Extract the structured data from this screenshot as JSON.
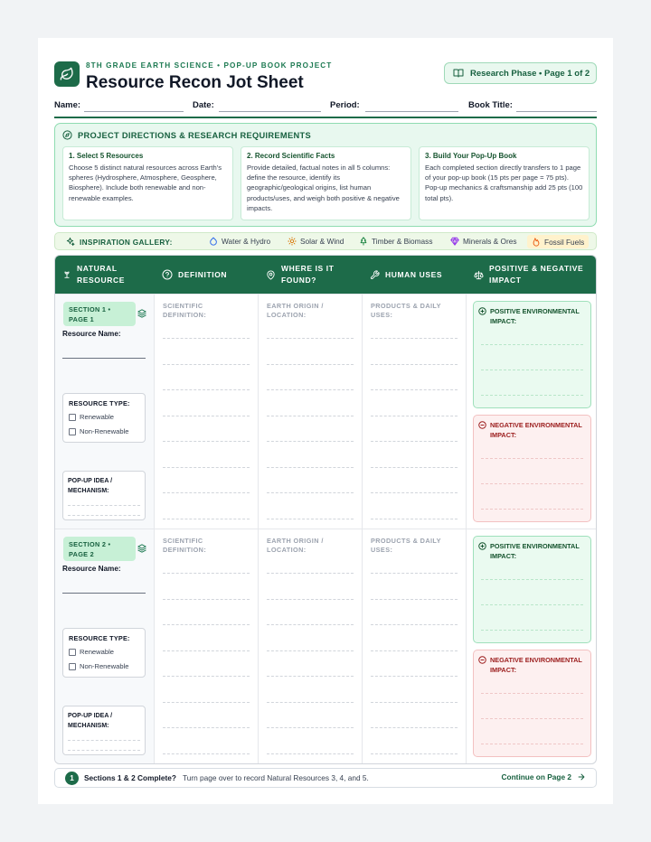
{
  "header": {
    "kicker": "8TH GRADE EARTH SCIENCE • POP-UP BOOK PROJECT",
    "title": "Resource Recon Jot Sheet",
    "phase_badge": "Research Phase • Page 1 of 2",
    "logo_icon": "leaf-icon",
    "phase_icon": "book-icon"
  },
  "info_fields": {
    "name": "Name:",
    "date": "Date:",
    "period": "Period:",
    "book_title": "Book Title:"
  },
  "directions": {
    "heading": "PROJECT DIRECTIONS & RESEARCH REQUIREMENTS",
    "icon": "compass-icon",
    "cards": [
      {
        "title": "1. Select 5 Resources",
        "body": "Choose 5 distinct natural resources across Earth's spheres (Hydrosphere, Atmosphere, Geosphere, Biosphere). Include both renewable and non-renewable examples."
      },
      {
        "title": "2. Record Scientific Facts",
        "body": "Provide detailed, factual notes in all 5 columns: define the resource, identify its geographic/geological origins, list human products/uses, and weigh both positive & negative impacts."
      },
      {
        "title": "3. Build Your Pop-Up Book",
        "body": "Each completed section directly transfers to 1 page of your pop-up book (15 pts per page = 75 pts). Pop-up mechanics & craftsmanship add 25 pts (100 total pts)."
      }
    ]
  },
  "gallery": {
    "label": "INSPIRATION GALLERY:",
    "items": [
      {
        "label": "Water & Hydro",
        "icon": "droplet-icon"
      },
      {
        "label": "Solar & Wind",
        "icon": "sun-icon"
      },
      {
        "label": "Timber & Biomass",
        "icon": "tree-icon"
      },
      {
        "label": "Minerals & Ores",
        "icon": "gem-icon"
      },
      {
        "label": "Fossil Fuels",
        "icon": "flame-icon"
      }
    ]
  },
  "table": {
    "headers": [
      {
        "label_line1": "NATURAL",
        "label_line2": "RESOURCE",
        "icon": "sprout-icon"
      },
      {
        "label_line1": "DEFINITION",
        "label_line2": "",
        "icon": "help-circle-icon"
      },
      {
        "label_line1": "WHERE IS IT",
        "label_line2": "FOUND?",
        "icon": "map-pin-icon"
      },
      {
        "label_line1": "HUMAN USES",
        "label_line2": "",
        "icon": "wrench-icon"
      },
      {
        "label_line1": "POSITIVE & NEGATIVE",
        "label_line2": "IMPACT",
        "icon": "scale-icon"
      }
    ],
    "sections": [
      {
        "badge_line1": "SECTION 1 •",
        "badge_line2": "PAGE 1",
        "resource_name": "Resource Name:",
        "resource_type": "RESOURCE TYPE:",
        "renewable": "Renewable",
        "non_renewable": "Non-Renewable",
        "popup_line1": "POP-UP IDEA /",
        "popup_line2": "MECHANISM:",
        "definition_line1": "SCIENTIFIC",
        "definition_line2": "DEFINITION:",
        "origin_line1": "EARTH ORIGIN /",
        "origin_line2": "LOCATION:",
        "uses_line1": "PRODUCTS & DAILY",
        "uses_line2": "USES:",
        "positive_line1": "POSITIVE ENVIRONMENTAL",
        "positive_line2": "IMPACT:",
        "negative_line1": "NEGATIVE ENVIRONMENTAL",
        "negative_line2": "IMPACT:"
      },
      {
        "badge_line1": "SECTION 2 •",
        "badge_line2": "PAGE 2",
        "resource_name": "Resource Name:",
        "resource_type": "RESOURCE TYPE:",
        "renewable": "Renewable",
        "non_renewable": "Non-Renewable",
        "popup_line1": "POP-UP IDEA /",
        "popup_line2": "MECHANISM:",
        "definition_line1": "SCIENTIFIC",
        "definition_line2": "DEFINITION:",
        "origin_line1": "EARTH ORIGIN /",
        "origin_line2": "LOCATION:",
        "uses_line1": "PRODUCTS & DAILY",
        "uses_line2": "USES:",
        "positive_line1": "POSITIVE ENVIRONMENTAL",
        "positive_line2": "IMPACT:",
        "negative_line1": "NEGATIVE ENVIRONMENTAL",
        "negative_line2": "IMPACT:"
      }
    ]
  },
  "footer": {
    "step": "1",
    "bold": "Sections 1 & 2 Complete?",
    "text": "Turn page over to record Natural Resources 3, 4, and 5.",
    "cta": "Continue on Page 2",
    "cta_icon": "arrow-right-icon"
  },
  "colors": {
    "primary": "#1d6b49",
    "positive_bg": "#eafaf0",
    "negative_bg": "#fdf0f0"
  }
}
